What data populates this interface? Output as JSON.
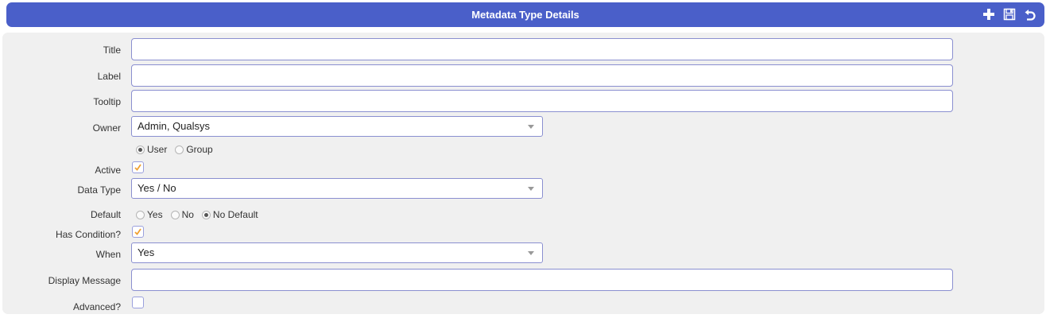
{
  "header": {
    "title": "Metadata Type Details",
    "actions": [
      {
        "name": "add-icon"
      },
      {
        "name": "save-icon"
      },
      {
        "name": "undo-icon"
      }
    ]
  },
  "form": {
    "title": {
      "label": "Title",
      "value": ""
    },
    "label": {
      "label": "Label",
      "value": ""
    },
    "tooltip": {
      "label": "Tooltip",
      "value": ""
    },
    "owner": {
      "label": "Owner",
      "value": "Admin, Qualsys",
      "type_options": [
        {
          "label": "User",
          "selected": true
        },
        {
          "label": "Group",
          "selected": false
        }
      ]
    },
    "active": {
      "label": "Active",
      "checked": true
    },
    "data_type": {
      "label": "Data Type",
      "value": "Yes / No"
    },
    "default": {
      "label": "Default",
      "options": [
        {
          "label": "Yes",
          "selected": false
        },
        {
          "label": "No",
          "selected": false
        },
        {
          "label": "No Default",
          "selected": true
        }
      ]
    },
    "has_condition": {
      "label": "Has Condition?",
      "checked": true
    },
    "when": {
      "label": "When",
      "value": "Yes"
    },
    "display_message": {
      "label": "Display Message",
      "value": ""
    },
    "advanced": {
      "label": "Advanced?",
      "checked": false
    }
  },
  "colors": {
    "header_bg": "#4a5fc9",
    "panel_bg": "#f0f0f0",
    "field_border": "#8a8fd0",
    "check_mark": "#f0a030"
  }
}
